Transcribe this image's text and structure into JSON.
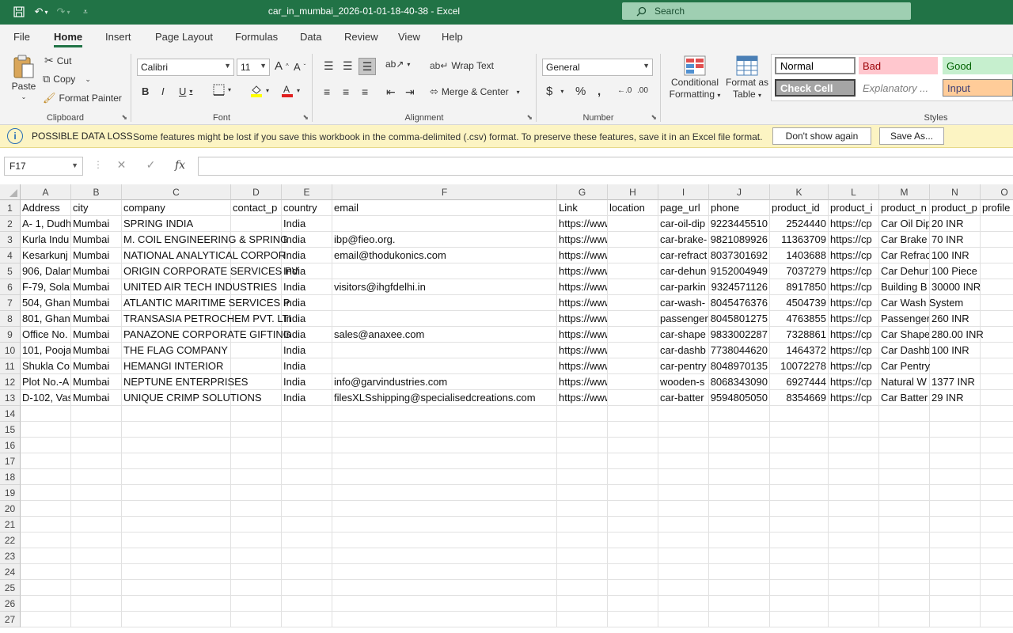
{
  "titlebar": {
    "title": "car_in_mumbai_2026-01-01-18-40-38  -  Excel",
    "search_placeholder": "Search"
  },
  "menu": [
    "File",
    "Home",
    "Insert",
    "Page Layout",
    "Formulas",
    "Data",
    "Review",
    "View",
    "Help"
  ],
  "ribbon": {
    "clipboard": {
      "paste": "Paste",
      "cut": "Cut",
      "copy": "Copy",
      "format_painter": "Format Painter",
      "label": "Clipboard"
    },
    "font": {
      "name": "Calibri",
      "size": "11",
      "label": "Font"
    },
    "alignment": {
      "wrap_text": "Wrap Text",
      "merge_center": "Merge & Center",
      "label": "Alignment"
    },
    "number": {
      "format": "General",
      "label": "Number"
    },
    "styles": {
      "conditional_formatting_1": "Conditional",
      "conditional_formatting_2": "Formatting",
      "format_as_table_1": "Format as",
      "format_as_table_2": "Table",
      "normal": "Normal",
      "bad": "Bad",
      "good": "Good",
      "check_cell": "Check Cell",
      "explanatory": "Explanatory ...",
      "input": "Input",
      "label": "Styles"
    }
  },
  "infobar": {
    "title": "POSSIBLE DATA LOSS",
    "message": "Some features might be lost if you save this workbook in the comma-delimited (.csv) format. To preserve these features, save it in an Excel file format.",
    "dont_show": "Don't show again",
    "save_as": "Save As..."
  },
  "formulabar": {
    "name_box": "F17",
    "fx": "fx",
    "value": ""
  },
  "sheet": {
    "columns": [
      "A",
      "B",
      "C",
      "D",
      "E",
      "F",
      "G",
      "H",
      "I",
      "J",
      "K",
      "L",
      "M",
      "N",
      "O"
    ],
    "row_numbers": [
      "1",
      "2",
      "3",
      "4",
      "5",
      "6",
      "7",
      "8",
      "9",
      "10",
      "11",
      "12",
      "13",
      "14",
      "15",
      "16",
      "17",
      "18",
      "19",
      "20",
      "21",
      "22",
      "23",
      "24",
      "25",
      "26",
      "27"
    ],
    "rows": [
      [
        "Address",
        "city",
        "company",
        "contact_p",
        "country",
        "email",
        "Link",
        "location",
        "page_url",
        "phone",
        "product_id",
        "product_i",
        "product_n",
        "product_p",
        "profile"
      ],
      [
        "A- 1, Dudh",
        "Mumbai",
        "SPRING INDIA",
        "",
        "India",
        "",
        "https://www.tradein",
        "",
        "car-oil-dip",
        "9223445510",
        "2524440",
        "https://cp",
        "Car Oil Dip",
        "20 INR",
        ""
      ],
      [
        "Kurla Indu",
        "Mumbai",
        "M. COIL ENGINEERING & SPRING",
        "",
        "India",
        "ibp@fieo.org.",
        "https://www.tradein",
        "",
        "car-brake-",
        "9821089926",
        "11363709",
        "https://cp",
        "Car Brake",
        "70 INR",
        ""
      ],
      [
        "Kesarkunj",
        "Mumbai",
        "NATIONAL ANALYTICAL CORPOR",
        "",
        "India",
        "email@thodukonics.com",
        "https://www.tradein",
        "",
        "car-refract",
        "8037301692",
        "1403688",
        "https://cp",
        "Car Refrac",
        "100 INR",
        ""
      ],
      [
        "906, Dalan",
        "Mumbai",
        "ORIGIN CORPORATE SERVICES PV",
        "",
        "India",
        "",
        "https://www.tradein",
        "",
        "car-dehun",
        "9152004949",
        "7037279",
        "https://cp",
        "Car Dehur",
        "100 Piece",
        ""
      ],
      [
        "F-79, Solar",
        "Mumbai",
        "UNITED AIR TECH INDUSTRIES",
        "",
        "India",
        "visitors@ihgfdelhi.in",
        "https://www.tradein",
        "",
        "car-parkin",
        "9324571126",
        "8917850",
        "https://cp",
        "Building B",
        "30000 INR",
        ""
      ],
      [
        "504, Ghan",
        "Mumbai",
        "ATLANTIC MARITIME SERVICES P",
        "",
        "India",
        "",
        "https://www.tradein",
        "",
        "car-wash-",
        "8045476376",
        "4504739",
        "https://cp",
        "Car Wash System",
        "",
        ""
      ],
      [
        "801, Ghan",
        "Mumbai",
        "TRANSASIA PETROCHEM PVT. LTI",
        "",
        "India",
        "",
        "https://www.tradein",
        "",
        "passenger",
        "8045801275",
        "4763855",
        "https://cp",
        "Passenger",
        "260 INR",
        ""
      ],
      [
        "Office No.",
        "Mumbai",
        "PANAZONE CORPORATE GIFTING",
        "",
        "India",
        "sales@anaxee.com",
        "https://www.tradein",
        "",
        "car-shape",
        "9833002287",
        "7328861",
        "https://cp",
        "Car Shape",
        "280.00 INR",
        ""
      ],
      [
        "101, Pooja",
        "Mumbai",
        "THE FLAG COMPANY",
        "",
        "India",
        "",
        "https://www.tradein",
        "",
        "car-dashb",
        "7738044620",
        "1464372",
        "https://cp",
        "Car Dashb",
        "100 INR",
        ""
      ],
      [
        "Shukla Co",
        "Mumbai",
        "HEMANGI INTERIOR",
        "",
        "India",
        "",
        "https://www.tradein",
        "",
        "car-pentry",
        "8048970135",
        "10072278",
        "https://cp",
        "Car Pentry",
        "",
        ""
      ],
      [
        "Plot No.-A",
        "Mumbai",
        "NEPTUNE ENTERPRISES",
        "",
        "India",
        "info@garvindustries.com",
        "https://www.tradein",
        "",
        "wooden-s",
        "8068343090",
        "6927444",
        "https://cp",
        "Natural W",
        "1377 INR",
        ""
      ],
      [
        "D-102, Vas",
        "Mumbai",
        "UNIQUE CRIMP SOLUTIONS",
        "",
        "India",
        "filesXLSshipping@specialisedcreations.com",
        "https://www.tradein",
        "",
        "car-batter",
        "9594805050",
        "8354669",
        "https://cp",
        "Car Batter",
        "29 INR",
        ""
      ]
    ]
  }
}
